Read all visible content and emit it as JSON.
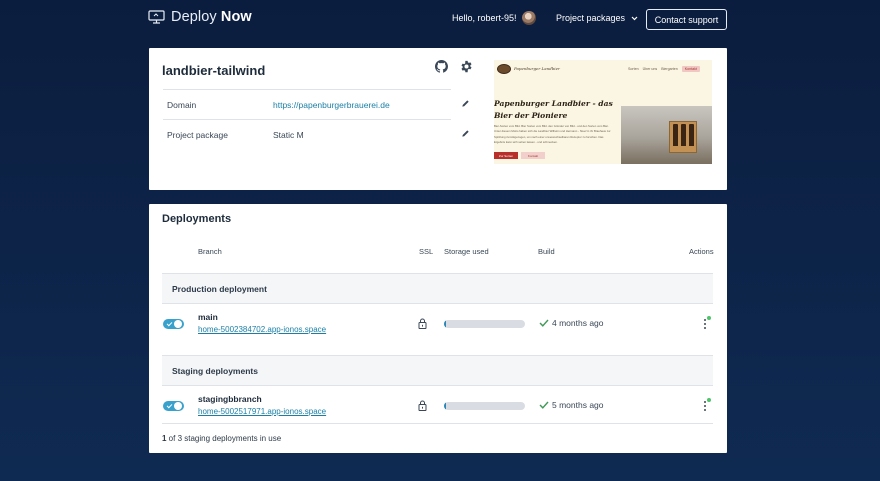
{
  "nav": {
    "brand_light": "Deploy ",
    "brand_bold": "Now",
    "greeting": "Hello, robert-95!",
    "project_packages": "Project packages",
    "contact_support": "Contact support"
  },
  "project": {
    "name": "landbier-tailwind",
    "rows": [
      {
        "label": "Domain",
        "value": "https://papenburgerbrauerei.de"
      },
      {
        "label": "Project package",
        "value": "Static M"
      }
    ],
    "preview": {
      "brand": "Papenburger Landbier",
      "nav_items": [
        "Sorten",
        "Über uns",
        "Biergarten"
      ],
      "nav_pill": "Kontakt",
      "headline": "Papenburger Landbier - das Bier der Pioniere",
      "body": "Bier-Sorten vom Bild. Bier Sorten vom Bild. den Gründer von Bild - und den Sorten vom Bier. Unter diesem Motto haben sich die Landbier Wilhelm und Hermann - Stuef in ihr Brauhaus zur Spitzlung zurückgezogen, um nach einer unverwechselbaren Rezeptur zu forschen. Das Ergebnis kann sich sehen lassen - und schmecken.",
      "btn_primary": "Zur Sorten",
      "btn_secondary": "Kontakt"
    }
  },
  "deployments": {
    "title": "Deployments",
    "columns": {
      "branch": "Branch",
      "ssl": "SSL",
      "storage": "Storage used",
      "build": "Build",
      "actions": "Actions"
    },
    "production_heading": "Production deployment",
    "staging_heading": "Staging deployments",
    "production": {
      "branch": "main",
      "url": "home-5002384702.app-ionos.space",
      "storage_fraction": 0.03,
      "build": "4 months ago"
    },
    "staging": {
      "branch": "stagingbbranch",
      "url": "home-5002517971.app-ionos.space",
      "storage_fraction": 0.03,
      "build": "5 months ago"
    },
    "footer_count": "1",
    "footer_rest": " of 3 staging deployments in use"
  },
  "colors": {
    "accent": "#39a2cc",
    "link": "#1a7fa6",
    "status_ok": "#4fc46a",
    "background": "#0b1d3e"
  }
}
